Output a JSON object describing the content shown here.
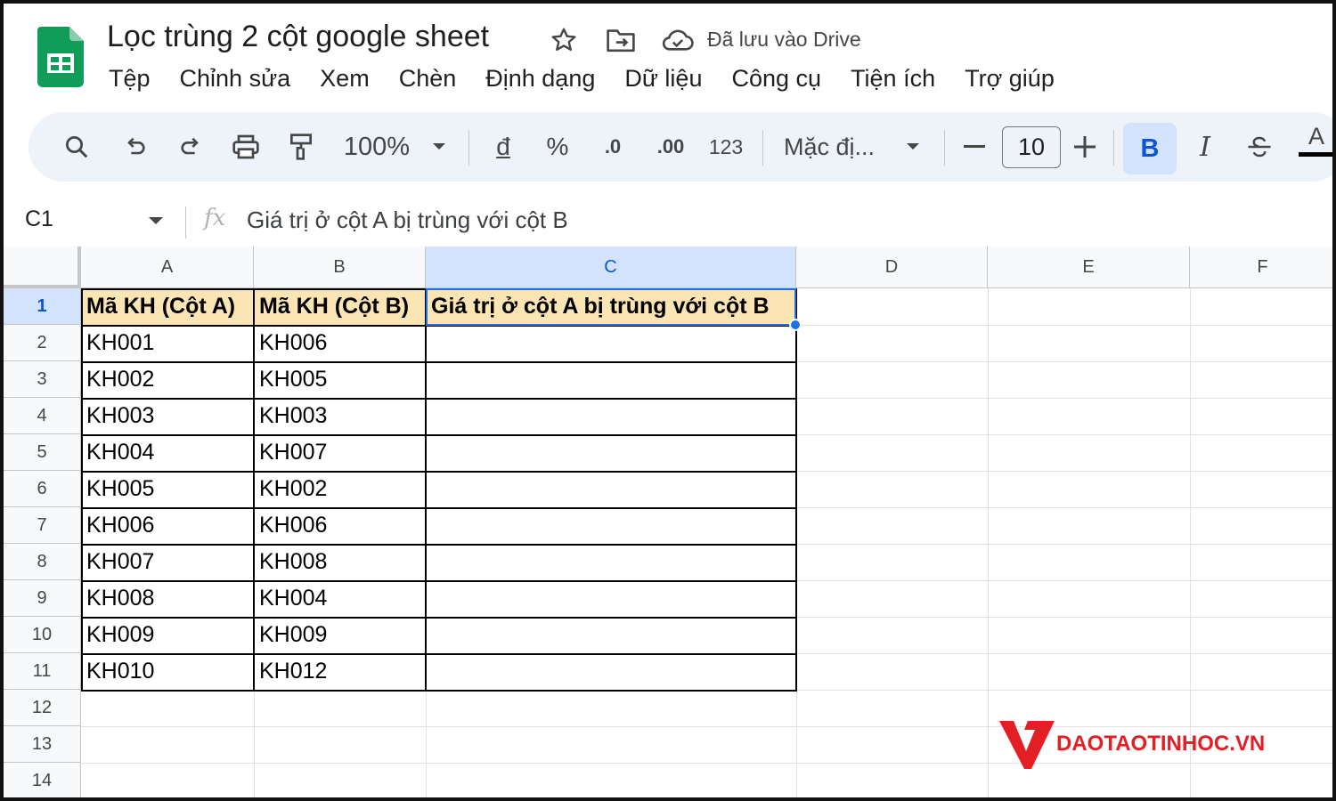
{
  "app": {
    "doc_title": "Lọc trùng 2 cột google sheet",
    "save_status": "Đã lưu vào Drive"
  },
  "menu": [
    "Tệp",
    "Chỉnh sửa",
    "Xem",
    "Chèn",
    "Định dạng",
    "Dữ liệu",
    "Công cụ",
    "Tiện ích",
    "Trợ giúp"
  ],
  "toolbar": {
    "zoom": "100%",
    "currency": "đ",
    "percent": "%",
    "dec_decrease": ".0",
    "dec_increase": ".00",
    "number_format": "123",
    "font": "Mặc đị...",
    "font_size": "10",
    "bold": "B",
    "italic": "I",
    "text_color": "A"
  },
  "formula_bar": {
    "name_box": "C1",
    "fx": "fx",
    "formula": "Giá trị ở cột A bị trùng với cột B"
  },
  "sheet": {
    "columns": [
      "A",
      "B",
      "C",
      "D",
      "E",
      "F"
    ],
    "selected_column": "C",
    "rows": [
      "1",
      "2",
      "3",
      "4",
      "5",
      "6",
      "7",
      "8",
      "9",
      "10",
      "11",
      "12",
      "13",
      "14"
    ],
    "selected_row": "1",
    "selected_cell": "C1",
    "header": {
      "a": "Mã KH (Cột A)",
      "b": "Mã KH (Cột B)",
      "c": "Giá trị ở cột A bị trùng với cột B"
    },
    "col_a": [
      "KH001",
      "KH002",
      "KH003",
      "KH004",
      "KH005",
      "KH006",
      "KH007",
      "KH008",
      "KH009",
      "KH010"
    ],
    "col_b": [
      "KH006",
      "KH005",
      "KH003",
      "KH007",
      "KH002",
      "KH006",
      "KH008",
      "KH004",
      "KH009",
      "KH012"
    ]
  },
  "watermark": {
    "text": "DAOTAOTINHOC.VN",
    "color": "#e31e24"
  },
  "colors": {
    "header_fill": "#fce5b4",
    "selection": "#1a73e8",
    "sheets_green": "#0f9d58"
  }
}
